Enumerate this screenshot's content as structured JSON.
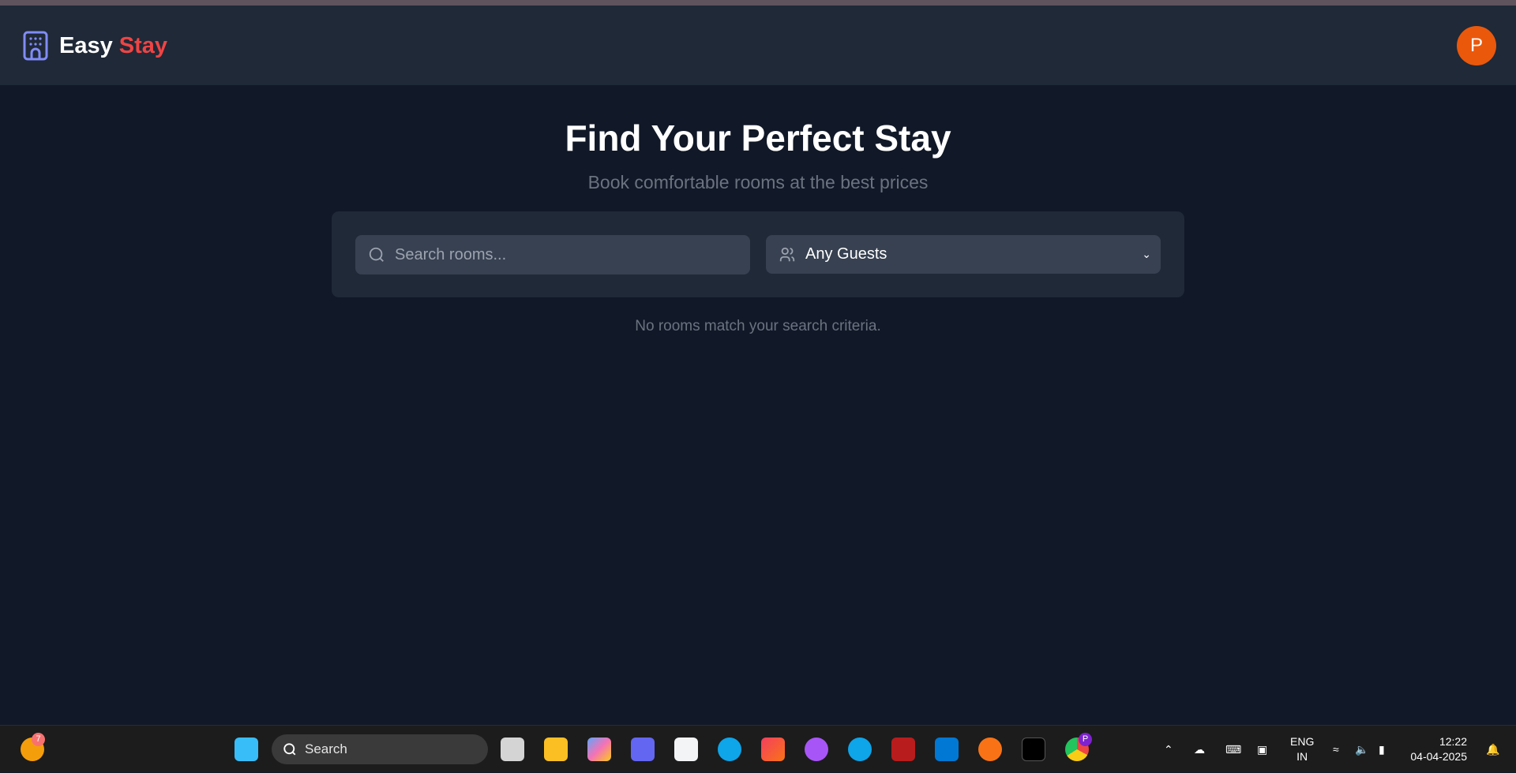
{
  "app": {
    "brand_first": "Easy",
    "brand_second": "Stay",
    "avatar_initial": "P"
  },
  "hero": {
    "title": "Find Your Perfect Stay",
    "subtitle": "Book comfortable rooms at the best prices"
  },
  "search": {
    "placeholder": "Search rooms...",
    "guests_selected": "Any Guests"
  },
  "results": {
    "empty_message": "No rooms match your search criteria."
  },
  "taskbar": {
    "search_label": "Search",
    "weather_badge": "7",
    "lang_line1": "ENG",
    "lang_line2": "IN",
    "time": "12:22",
    "date": "04-04-2025",
    "chrome_profile": "P"
  },
  "colors": {
    "accent": "#ef4444",
    "avatar": "#ea580c",
    "logo_icon": "#818cf8",
    "bg": "#111827",
    "header": "#1f2937",
    "field": "#374151"
  }
}
